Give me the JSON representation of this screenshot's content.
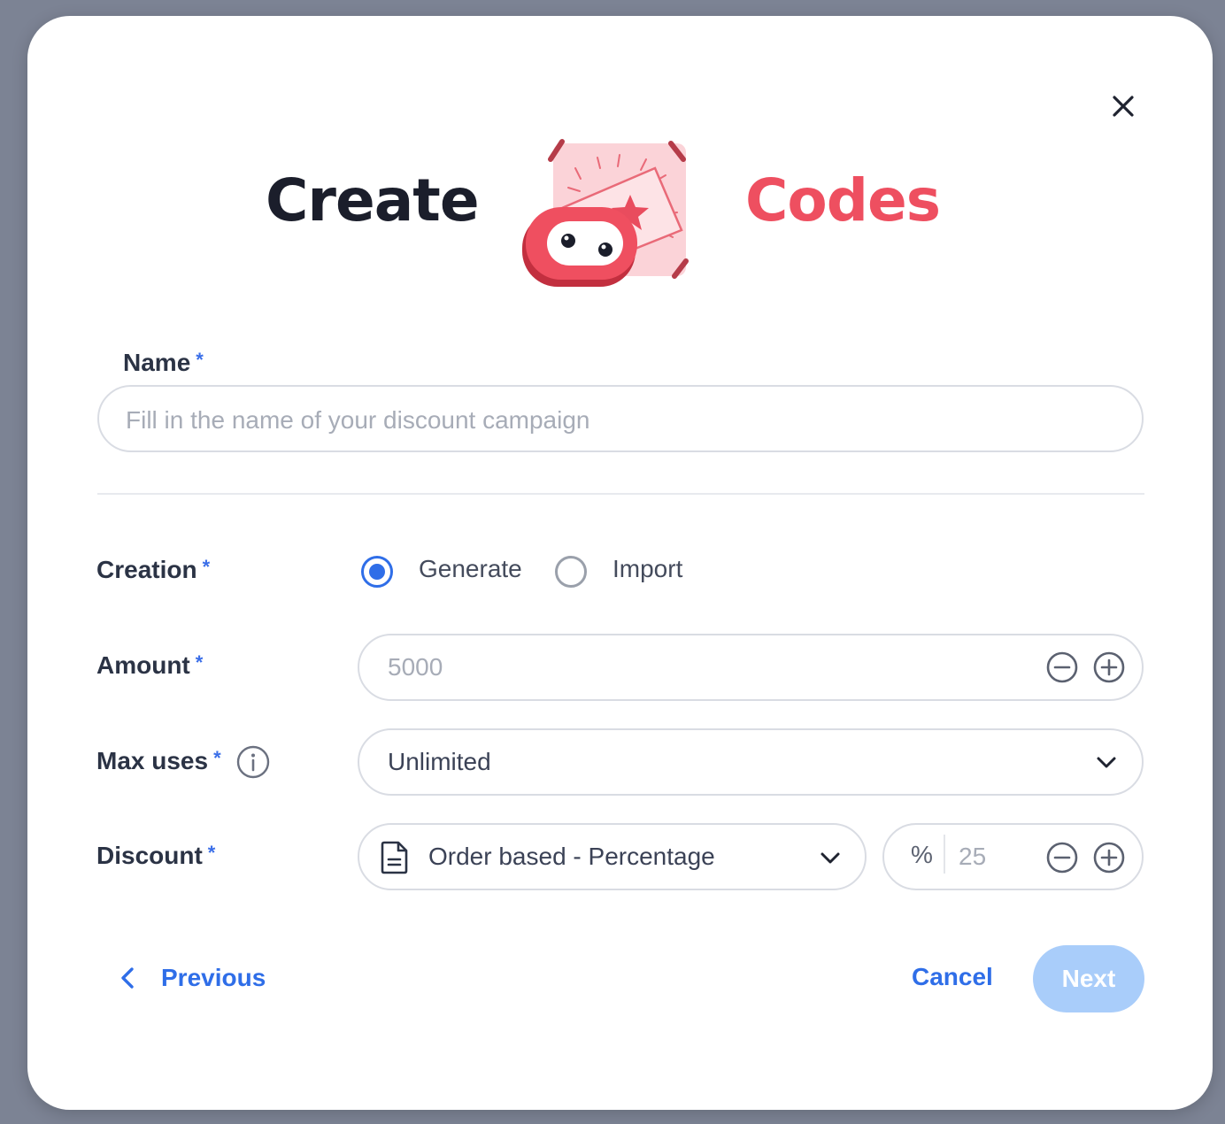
{
  "dialog": {
    "title_left": "Create",
    "title_right": "Codes",
    "accent_color": "#ee4f60",
    "primary_color": "#2f6ee8"
  },
  "name_field": {
    "label": "Name",
    "required_mark": "*",
    "placeholder": "Fill in the name of your discount campaign",
    "value": ""
  },
  "creation": {
    "label": "Creation",
    "required_mark": "*",
    "options": [
      {
        "label": "Generate",
        "selected": true
      },
      {
        "label": "Import",
        "selected": false
      }
    ]
  },
  "amount": {
    "label": "Amount",
    "required_mark": "*",
    "placeholder": "5000"
  },
  "max_uses": {
    "label": "Max uses",
    "required_mark": "*",
    "selected": "Unlimited"
  },
  "discount": {
    "label": "Discount",
    "required_mark": "*",
    "type_selected": "Order based - Percentage",
    "unit": "%",
    "value_placeholder": "25"
  },
  "footer": {
    "previous_label": "Previous",
    "cancel_label": "Cancel",
    "next_label": "Next"
  },
  "icons": {
    "close": "close-icon",
    "illustration": "ticket-mascot-illustration",
    "info": "info-icon",
    "minus": "minus-circle-icon",
    "plus": "plus-circle-icon",
    "chevron": "chevron-down-icon",
    "document": "document-icon",
    "back": "chevron-left-icon"
  }
}
